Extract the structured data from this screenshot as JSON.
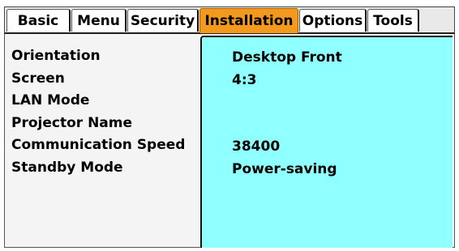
{
  "tabs": [
    {
      "label": "Basic",
      "active": false
    },
    {
      "label": "Menu",
      "active": false
    },
    {
      "label": "Security",
      "active": false
    },
    {
      "label": "Installation",
      "active": true
    },
    {
      "label": "Options",
      "active": false
    },
    {
      "label": "Tools",
      "active": false
    }
  ],
  "rows": [
    {
      "label": "Orientation",
      "value": "Desktop Front"
    },
    {
      "label": "Screen",
      "value": "4:3"
    },
    {
      "label": "LAN Mode",
      "value": ""
    },
    {
      "label": "Projector Name",
      "value": ""
    },
    {
      "label": "Communication Speed",
      "value": "38400"
    },
    {
      "label": "Standby Mode",
      "value": "Power-saving"
    }
  ],
  "colors": {
    "active_tab": "#f39a1e",
    "value_pane": "#8fffff",
    "tab_bg": "#ffffff"
  }
}
